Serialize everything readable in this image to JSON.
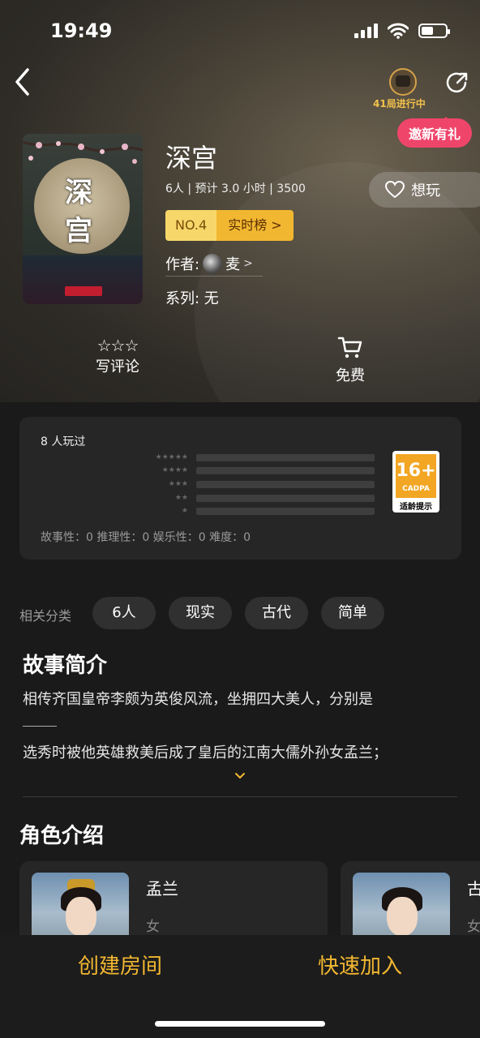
{
  "status": {
    "time": "19:49"
  },
  "header": {
    "live_text": "41局进行中",
    "invite_label": "邀新有礼"
  },
  "game": {
    "title": "深宫",
    "cover_chars": [
      "深",
      "宫"
    ],
    "meta": "6人 | 预计 3.0 小时 | 3500",
    "rank_no": "NO.4",
    "rank_board": "实时榜 >",
    "author_label": "作者:",
    "author_name": "麦",
    "series": "系列: 无",
    "wish_label": "想玩"
  },
  "actions": {
    "review_stars": "☆☆☆",
    "review_label": "写评论",
    "free_label": "免费"
  },
  "rating": {
    "played": "8 人玩过",
    "star_rows": [
      "★★★★★",
      "★★★★",
      "★★★",
      "★★",
      "★"
    ],
    "age_number": "16+",
    "age_org": "CADPA",
    "age_tip": "适龄提示",
    "scores": "故事性：0   推理性：0   娱乐性：0   难度：0"
  },
  "tags": {
    "label": "相关分类",
    "items": [
      "6人",
      "现实",
      "古代",
      "简单"
    ]
  },
  "story": {
    "heading": "故事简介",
    "line1": "相传齐国皇帝李颇为英俊风流，坐拥四大美人，分别是",
    "line2": "选秀时被他英雄救美后成了皇后的江南大儒外孙女孟兰；"
  },
  "roles": {
    "heading": "角色介绍",
    "items": [
      {
        "name": "孟兰",
        "sex": "女"
      },
      {
        "name": "古",
        "sex": "女"
      }
    ]
  },
  "bottom": {
    "create_label": "创建房间",
    "quick_label": "快速加入"
  },
  "colors": {
    "accent": "#f2b731",
    "invite": "#f0456b"
  }
}
